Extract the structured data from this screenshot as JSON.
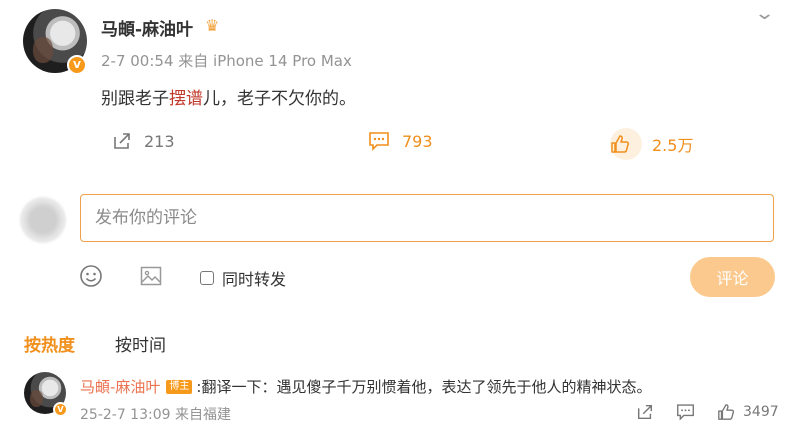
{
  "post": {
    "author": "马頔-麻油叶",
    "meta": "2-7 00:54  来自 iPhone 14 Pro Max",
    "content_before": "别跟老子",
    "content_highlight": "摆谱",
    "content_after": "儿，老子不欠你的。",
    "repost_count": "213",
    "comment_count": "793",
    "like_count": "2.5万"
  },
  "compose": {
    "placeholder": "发布你的评论",
    "sync_label": "同时转发",
    "submit_label": "评论"
  },
  "sort": {
    "hot_label": "按热度",
    "time_label": "按时间"
  },
  "comment": {
    "author": "马頔-麻油叶",
    "tag": "博主",
    "text": ":翻译一下：遇见傻子千万别惯着他，表达了领先于他人的精神状态。",
    "meta": "25-2-7 13:09  来自福建",
    "like_count": "3497"
  },
  "colors": {
    "accent": "#f08f1b",
    "badge": "#f79a1b",
    "name_link": "#eb7350",
    "highlight": "#c0392b"
  },
  "icons": [
    "chevron-down-icon",
    "crown-icon",
    "verified-icon",
    "repost-icon",
    "comment-icon",
    "like-icon",
    "emoji-icon",
    "image-icon"
  ]
}
